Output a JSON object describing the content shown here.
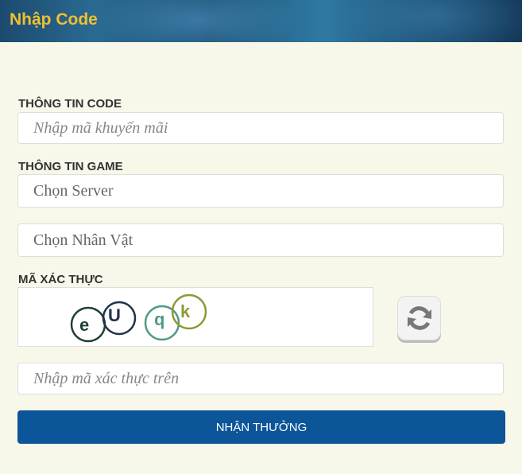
{
  "header": {
    "title": "Nhập Code"
  },
  "code_section": {
    "label": "THÔNG TIN CODE",
    "code_placeholder": "Nhập mã khuyến mãi"
  },
  "game_section": {
    "label": "THÔNG TIN GAME",
    "server_select": "Chọn Server",
    "character_select": "Chọn Nhân Vật"
  },
  "captcha_section": {
    "label": "MÃ XÁC THỰC",
    "captcha_chars": [
      "e",
      "U",
      "q",
      "k"
    ],
    "input_placeholder": "Nhập mã xác thực trên"
  },
  "submit": {
    "label": "NHẬN THƯỞNG"
  },
  "colors": {
    "header_title": "#f0c030",
    "button": "#0b5598",
    "background": "#f8f8ea"
  }
}
